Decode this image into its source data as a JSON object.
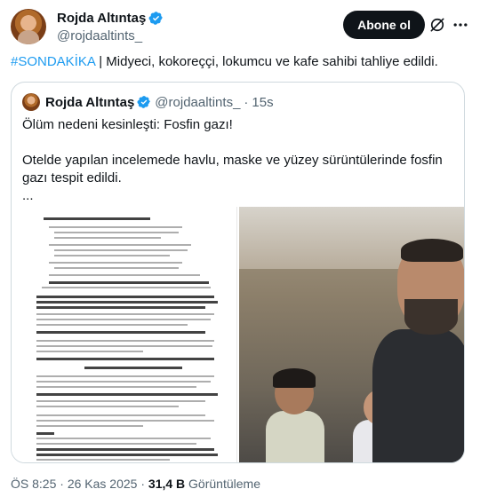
{
  "author": {
    "name": "Rojda Altıntaş",
    "handle": "@rojdaaltints_",
    "verified": true
  },
  "header": {
    "follow_label": "Abone ol",
    "grok_icon": "grok-icon",
    "more_icon": "more-icon"
  },
  "tweet": {
    "hashtag": "#SONDAKİKA",
    "text": " | Midyeci, kokoreççi, lokumcu ve kafe sahibi tahliye edildi."
  },
  "quote": {
    "name": "Rojda Altıntaş",
    "handle": "@rojdaaltints_",
    "dot": "·",
    "time": "15s",
    "line1": "Ölüm nedeni kesinleşti: Fosfin gazı!",
    "line2": "Otelde yapılan incelemede havlu, maske ve yüzey sürüntülerinde fosfin gazı tespit edildi.",
    "line3": "...",
    "media": [
      "document-image",
      "selfie-photo"
    ]
  },
  "meta": {
    "time": "ÖS 8:25",
    "sep1": " · ",
    "date": "26 Kas 2025",
    "sep2": " · ",
    "views": "31,4 B",
    "views_label": " Görüntüleme"
  },
  "colors": {
    "accent": "#1d9bf0",
    "text": "#0f1419",
    "muted": "#536471",
    "border": "#cfd9de"
  }
}
